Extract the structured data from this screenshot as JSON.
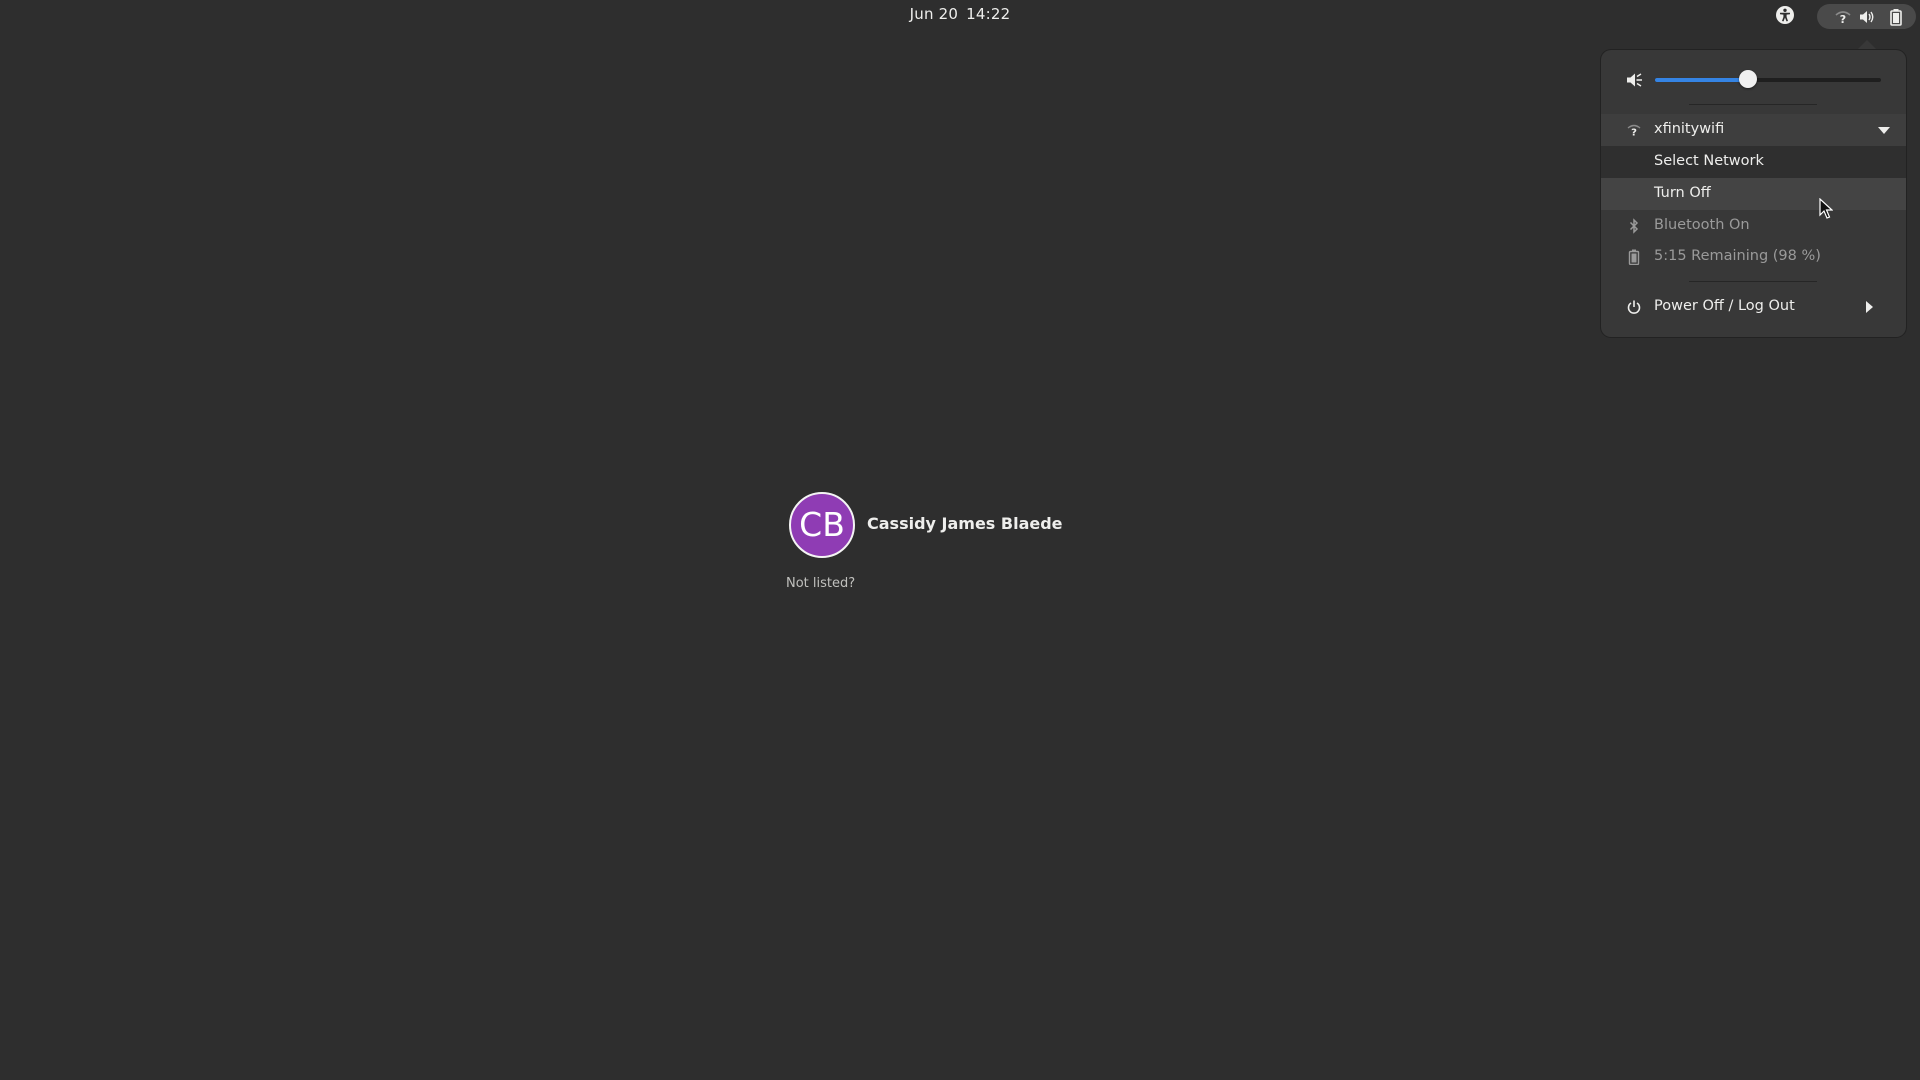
{
  "topbar": {
    "date": "Jun 20",
    "time": "14:22",
    "icons": [
      "accessibility-icon",
      "wifi-unknown-icon",
      "volume-icon",
      "battery-icon"
    ]
  },
  "system_menu": {
    "volume": {
      "icon": "volume-muted-icon",
      "level": 0.41,
      "accent": "#3584e4"
    },
    "wifi": {
      "icon": "wifi-unknown-icon",
      "label": "xfinitywifi",
      "expanded": true,
      "items": [
        {
          "label": "Select Network"
        },
        {
          "label": "Turn Off",
          "hovered": true
        }
      ]
    },
    "bluetooth": {
      "icon": "bluetooth-icon",
      "label": "Bluetooth On"
    },
    "battery": {
      "icon": "battery-icon",
      "label": "5:15 Remaining (98 %)"
    },
    "power": {
      "icon": "power-icon",
      "label": "Power Off / Log Out"
    }
  },
  "login": {
    "user": {
      "initials": "CB",
      "name": "Cassidy James Blaede",
      "avatar_color": "#8f3cb4"
    },
    "not_listed": "Not listed?"
  }
}
